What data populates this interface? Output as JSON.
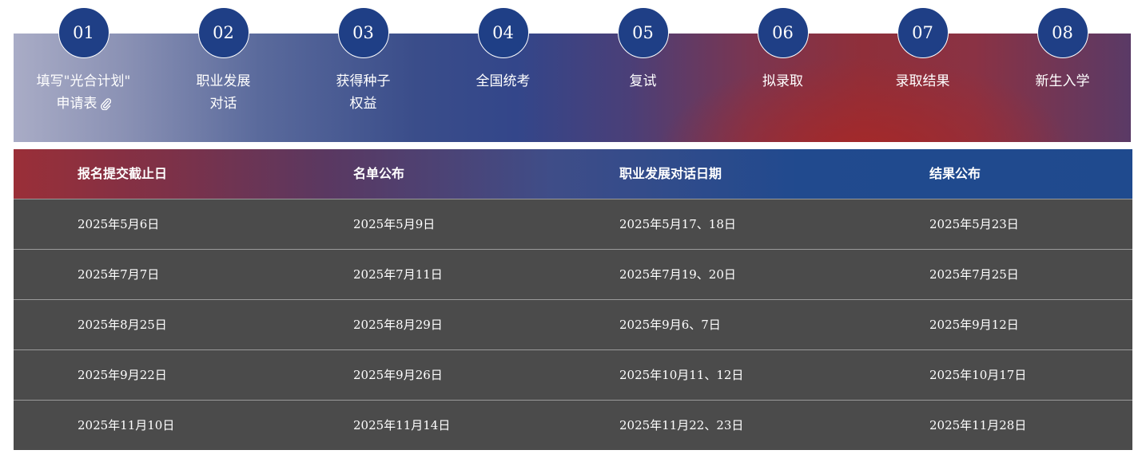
{
  "steps": [
    {
      "num": "01",
      "label": "填写\"光合计划\"\n申请表",
      "icon": "paperclip-icon"
    },
    {
      "num": "02",
      "label": "职业发展\n对话"
    },
    {
      "num": "03",
      "label": "获得种子\n权益"
    },
    {
      "num": "04",
      "label": "全国统考"
    },
    {
      "num": "05",
      "label": "复试"
    },
    {
      "num": "06",
      "label": "拟录取"
    },
    {
      "num": "07",
      "label": "录取结果"
    },
    {
      "num": "08",
      "label": "新生入学"
    }
  ],
  "schedule": {
    "headers": [
      "报名提交截止日",
      "名单公布",
      "职业发展对话日期",
      "结果公布"
    ],
    "rows": [
      [
        "2025年5月6日",
        "2025年5月9日",
        "2025年5月17、18日",
        "2025年5月23日"
      ],
      [
        "2025年7月7日",
        "2025年7月11日",
        "2025年7月19、20日",
        "2025年7月25日"
      ],
      [
        "2025年8月25日",
        "2025年8月29日",
        "2025年9月6、7日",
        "2025年9月12日"
      ],
      [
        "2025年9月22日",
        "2025年9月26日",
        "2025年10月11、12日",
        "2025年10月17日"
      ],
      [
        "2025年11月10日",
        "2025年11月14日",
        "2025年11月22、23日",
        "2025年11月28日"
      ]
    ]
  },
  "colors": {
    "step_circle": "#1f3f86",
    "row_bg": "#4b4b4b",
    "header_left": "#9a2f38",
    "header_right": "#1f4a8e"
  }
}
